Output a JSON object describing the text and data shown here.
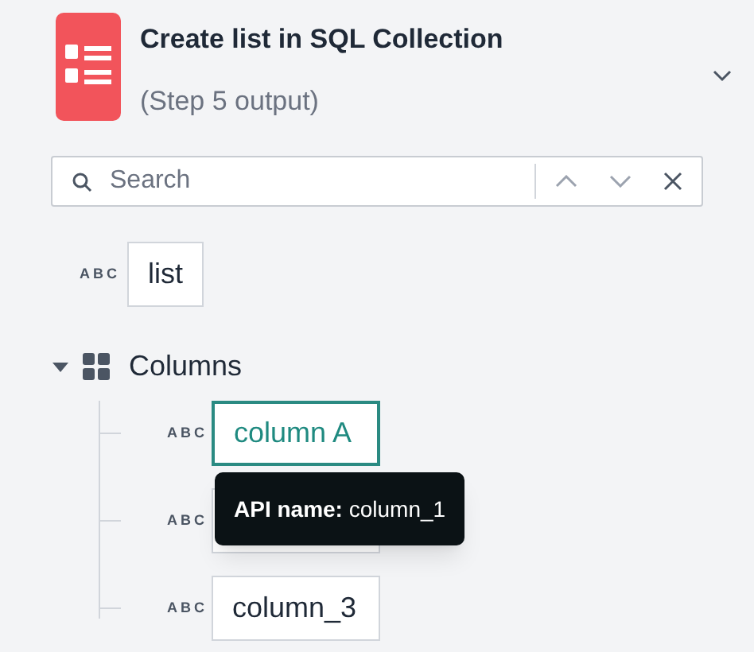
{
  "header": {
    "title": "Create list in SQL Collection",
    "subtitle": "(Step 5 output)"
  },
  "search": {
    "placeholder": "Search"
  },
  "fields": [
    {
      "type_tag": "ABC",
      "label": "list"
    }
  ],
  "group": {
    "label": "Columns",
    "expanded": true,
    "children": [
      {
        "type_tag": "ABC",
        "label": "column A",
        "selected": true,
        "tooltip": "**API name:** column_1"
      },
      {
        "type_tag": "ABC",
        "selected": false
      },
      {
        "type_tag": "ABC",
        "label": "column_3",
        "selected": false
      }
    ]
  }
}
